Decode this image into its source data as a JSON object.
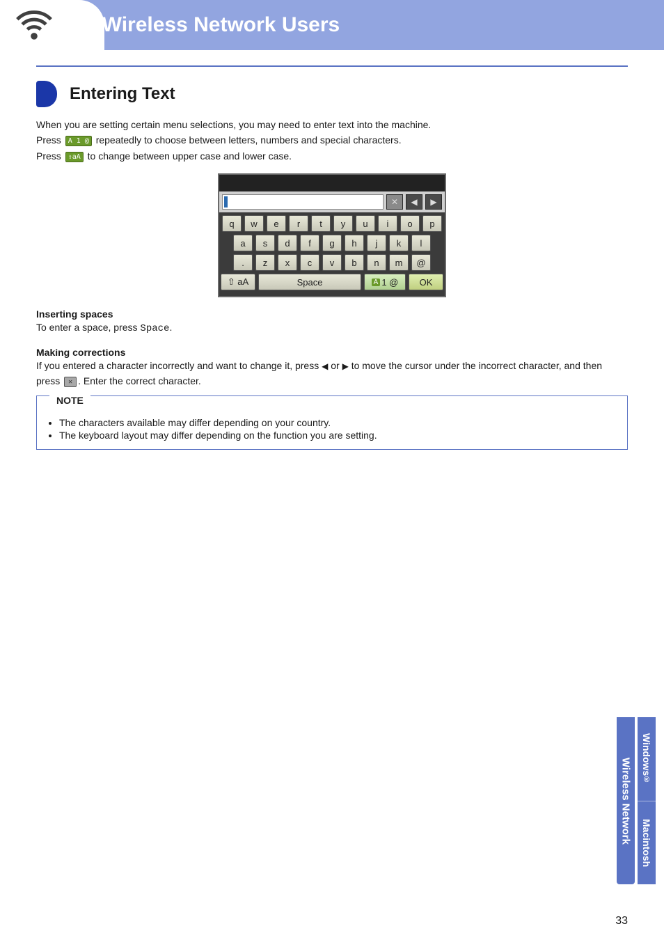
{
  "banner": {
    "title": "For Wireless Network Users"
  },
  "section": {
    "title": "Entering Text"
  },
  "body": {
    "intro_line1": "When you are setting certain menu selections, you may need to enter text into the machine.",
    "press1_a": "Press ",
    "press1_b": " repeatedly to choose between letters, numbers and special characters.",
    "press2_a": "Press ",
    "press2_b": " to change between upper case and lower case.",
    "btn_mode_label": "A 1 @",
    "btn_shift_label": "⇧aA"
  },
  "keyboard": {
    "row1": [
      "q",
      "w",
      "e",
      "r",
      "t",
      "y",
      "u",
      "i",
      "o",
      "p"
    ],
    "row2": [
      "a",
      "s",
      "d",
      "f",
      "g",
      "h",
      "j",
      "k",
      "l"
    ],
    "row3": [
      ".",
      "z",
      "x",
      "c",
      "v",
      "b",
      "n",
      "m",
      "@"
    ],
    "shift": "⇧ aA",
    "space": "Space",
    "mode_A": "A",
    "mode_rest": "1 @",
    "ok": "OK",
    "back_icon": "✕",
    "nav_left": "◀",
    "nav_right": "▶"
  },
  "spaces": {
    "heading": "Inserting spaces",
    "line_a": "To enter a space, press ",
    "space_word": "Space",
    "line_b": "."
  },
  "corrections": {
    "heading": "Making corrections",
    "line_a": "If you entered a character incorrectly and want to change it, press ",
    "tri_left": "◀",
    "or": " or ",
    "tri_right": "▶",
    "line_b": " to move the cursor under the incorrect character, and then press ",
    "bksp_icon": "✕",
    "line_c": ". Enter the correct character."
  },
  "note": {
    "title": "NOTE",
    "items": [
      "The characters available may differ depending on your country.",
      "The keyboard layout may differ depending on the function you are setting."
    ]
  },
  "tabs": {
    "wireless": "Wireless Network",
    "windows": "Windows",
    "reg": "®",
    "mac": "Macintosh"
  },
  "page_number": "33"
}
